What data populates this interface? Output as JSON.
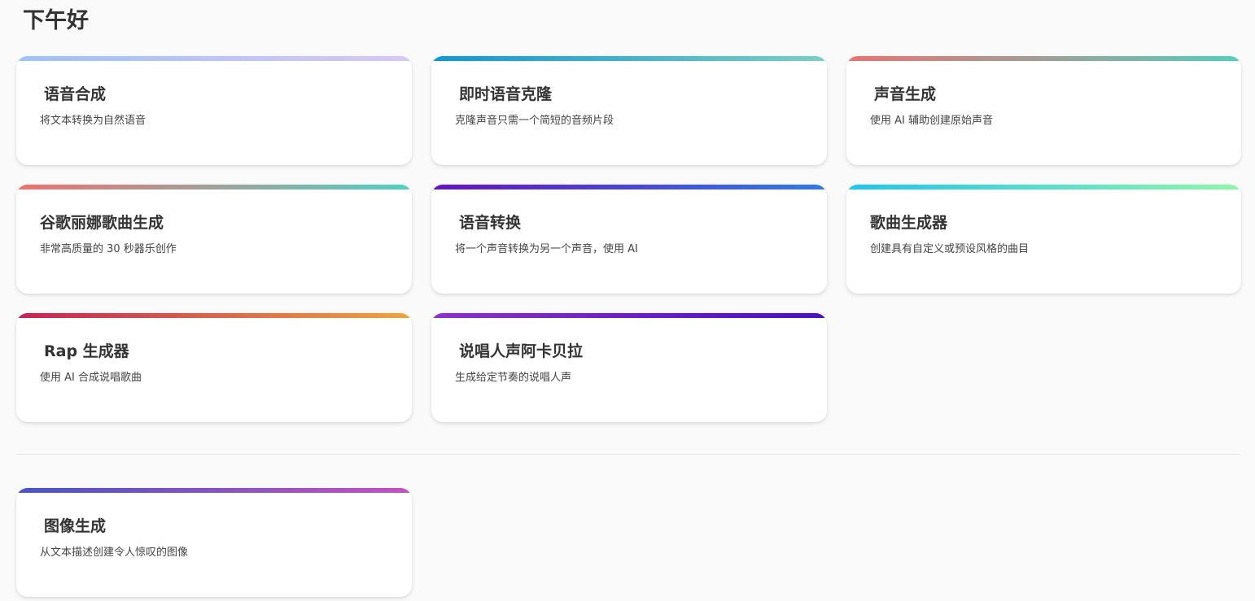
{
  "greeting": "下午好",
  "cards": [
    {
      "title": "语音合成",
      "desc": "将文本转换为自然语音",
      "gradient": [
        "#9ec2f5",
        "#d9c6f6"
      ]
    },
    {
      "title": "即时语音克隆",
      "desc": "克隆声音只需一个简短的音频片段",
      "gradient": [
        "#0f97d4",
        "#79d0c5"
      ]
    },
    {
      "title": "声音生成",
      "desc": "使用 AI 辅助创建原始声音",
      "gradient": [
        "#ee7070",
        "#4fd0bf"
      ]
    },
    {
      "title": "谷歌丽娜歌曲生成",
      "desc": "非常高质量的 30 秒器乐创作",
      "gradient": [
        "#f07070",
        "#4fd2c2"
      ]
    },
    {
      "title": "语音转换",
      "desc": "将一个声音转换为另一个声音，使用 AI",
      "gradient": [
        "#6512c0",
        "#2f7be8"
      ]
    },
    {
      "title": "歌曲生成器",
      "desc": "创建具有自定义或预设风格的曲目",
      "gradient": [
        "#1ec6ee",
        "#8ff7a8"
      ]
    },
    {
      "title": "Rap 生成器",
      "desc": "使用 AI 合成说唱歌曲",
      "gradient": [
        "#cc1f56",
        "#f1a43a"
      ]
    },
    {
      "title": "说唱人声阿卡贝拉",
      "desc": "生成给定节奏的说唱人声",
      "gradient": [
        "#8c2fd6",
        "#4c0cc8"
      ]
    }
  ],
  "image_card": {
    "title": "图像生成",
    "desc": "从文本描述创建令人惊叹的图像",
    "gradient": [
      "#4a55c0",
      "#c253bd"
    ]
  }
}
